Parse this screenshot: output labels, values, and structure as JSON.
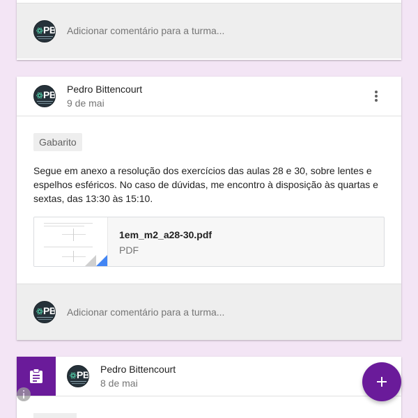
{
  "colors": {
    "page_background": "#f3e5f5",
    "accent": "#6a1b9a",
    "comment_bar": "#eeeeee"
  },
  "top_card": {
    "comment_placeholder": "Adicionar comentário para a turma...",
    "avatar_initials": "PB"
  },
  "post": {
    "author": "Pedro Bittencourt",
    "date": "9 de mai",
    "avatar_initials": "PB",
    "menu_icon": "more-vert-icon",
    "tag": "Gabarito",
    "body": "Segue em anexo a resolução dos exercícios das aulas 28 e 30, sobre lentes e espelhos esféricos. No caso de dúvidas, me encontro à disposição às quartas e sextas, das 13:30 às 15:10.",
    "attachment": {
      "name": "1em_m2_a28-30.pdf",
      "type": "PDF"
    },
    "comment_placeholder": "Adicionar comentário para a turma..."
  },
  "assignment_post": {
    "author": "Pedro Bittencourt",
    "date": "8 de mai",
    "avatar_initials": "PB",
    "type_icon": "assignment-icon"
  },
  "fab": {
    "icon": "plus-icon"
  }
}
